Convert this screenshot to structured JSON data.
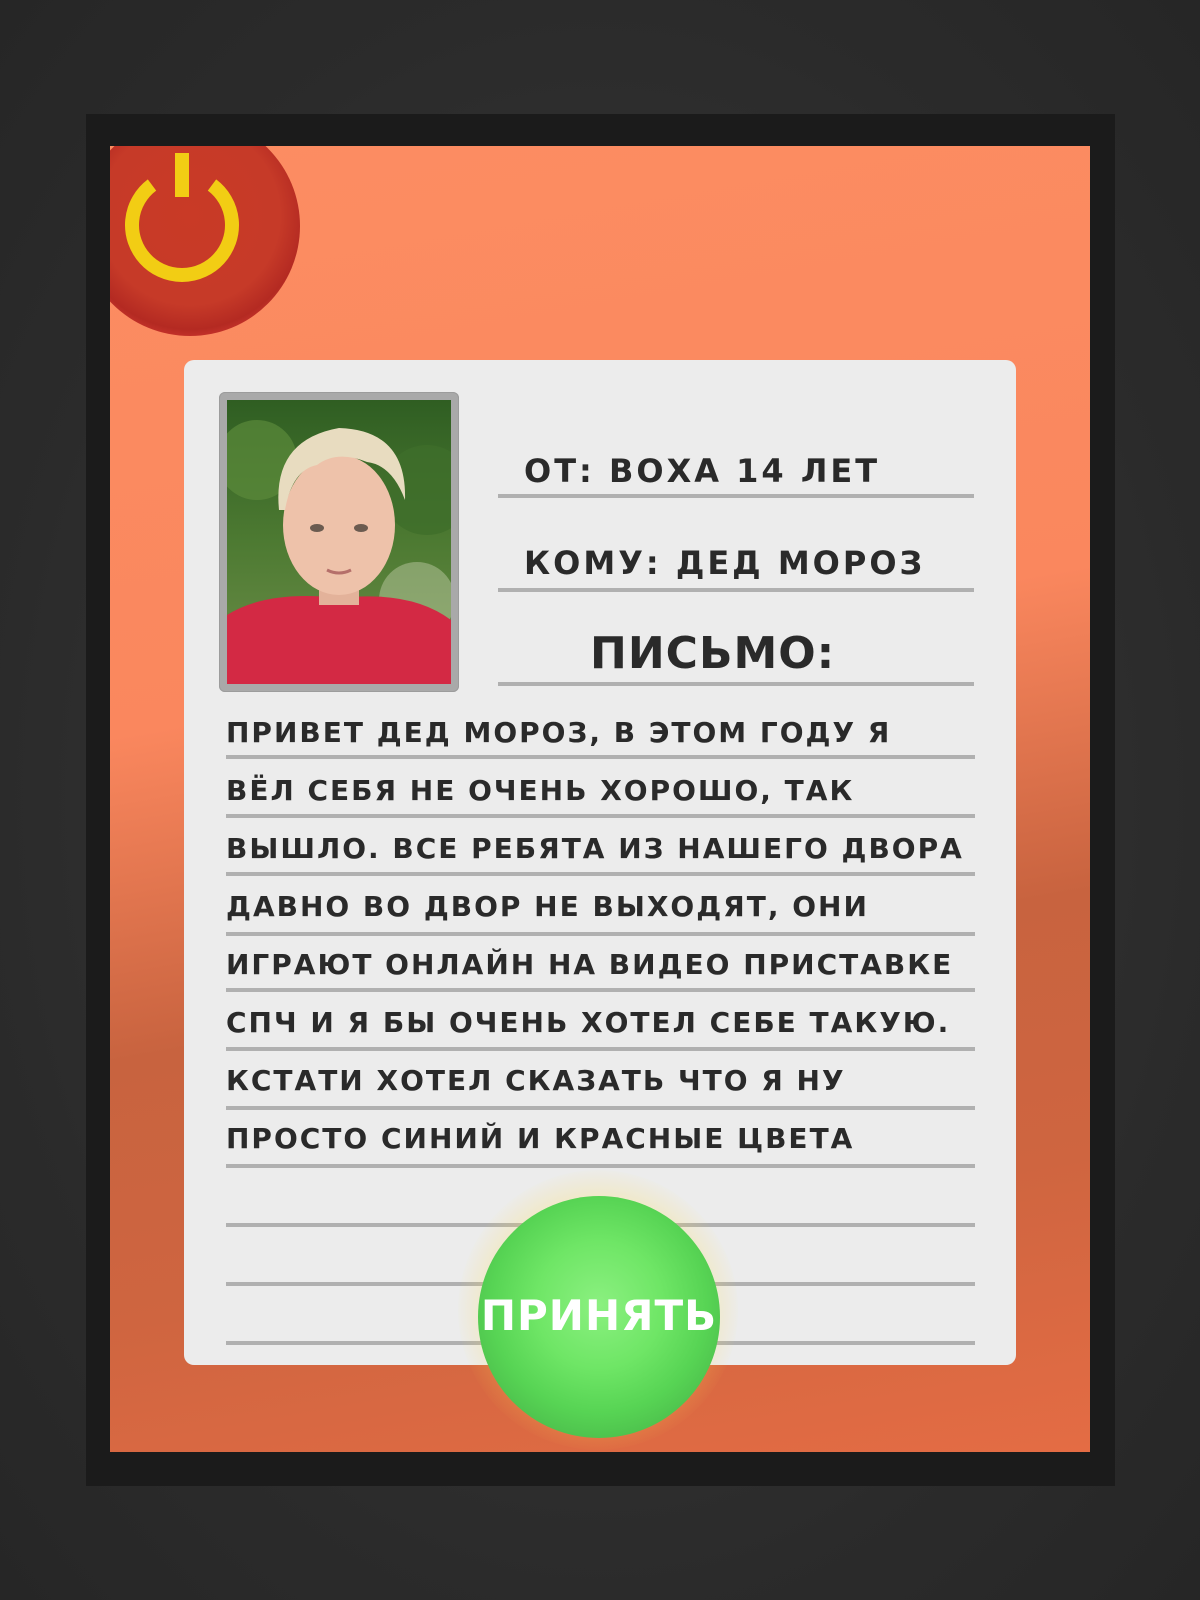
{
  "header": {
    "from": "ОТ: ВОХА 14 ЛЕТ",
    "to": "КОМУ: ДЕД МОРОЗ",
    "letter_title": "ПИСЬМО:"
  },
  "letter_lines": [
    "ПРИВЕТ ДЕД МОРОЗ, В ЭТОМ ГОДУ Я",
    "ВЁЛ СЕБЯ НЕ ОЧЕНЬ ХОРОШО, ТАК",
    "ВЫШЛО. ВСЕ РЕБЯТА ИЗ НАШЕГО ДВОРА",
    "ДАВНО ВО ДВОР НЕ ВЫХОДЯТ, ОНИ",
    "ИГРАЮТ ОНЛАЙН НА ВИДЕО ПРИСТАВКЕ",
    "СПЧ И Я БЫ ОЧЕНЬ ХОТЕЛ СЕБЕ ТАКУЮ.",
    "КСТАТИ ХОТЕЛ СКАЗАТЬ ЧТО Я НУ",
    "ПРОСТО СИНИЙ И КРАСНЫЕ ЦВЕТА"
  ],
  "buttons": {
    "accept_label": "ПРИНЯТЬ",
    "power_icon": "power-icon"
  },
  "colors": {
    "screen_bg": "#fc8d62",
    "paper": "#ececec",
    "accept": "#57d454",
    "power_ring": "#f2433c",
    "power_symbol": "#f2cd14"
  }
}
